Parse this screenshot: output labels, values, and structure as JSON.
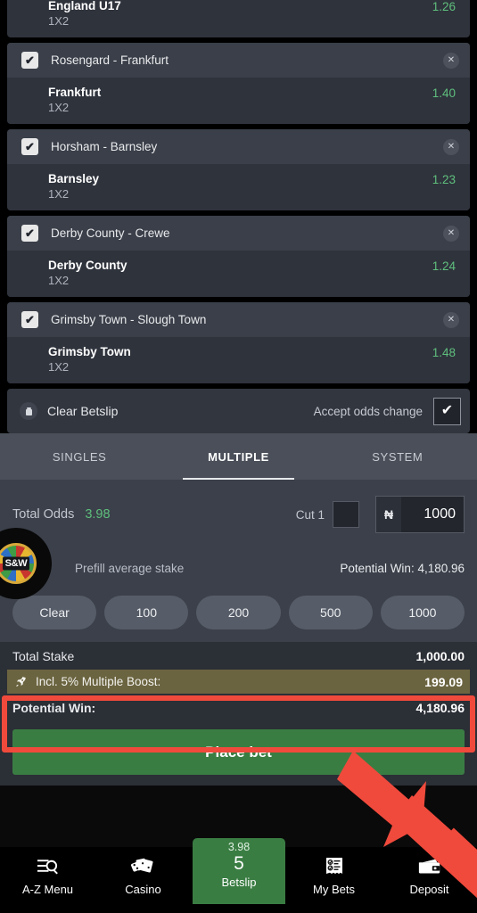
{
  "betslip": {
    "items": [
      {
        "match": "",
        "pick": "England U17",
        "market": "1X2",
        "odds": "1.26",
        "partial": true
      },
      {
        "match": "Rosengard - Frankfurt",
        "pick": "Frankfurt",
        "market": "1X2",
        "odds": "1.40"
      },
      {
        "match": "Horsham - Barnsley",
        "pick": "Barnsley",
        "market": "1X2",
        "odds": "1.23"
      },
      {
        "match": "Derby County - Crewe",
        "pick": "Derby County",
        "market": "1X2",
        "odds": "1.24"
      },
      {
        "match": "Grimsby Town - Slough Town",
        "pick": "Grimsby Town",
        "market": "1X2",
        "odds": "1.48"
      }
    ],
    "clear_label": "Clear Betslip",
    "accept_odds_label": "Accept odds change",
    "accept_odds_checked": true,
    "checkbox_glyph": "✔",
    "close_glyph": "✕"
  },
  "tabs": [
    {
      "label": "SINGLES",
      "active": false
    },
    {
      "label": "MULTIPLE",
      "active": true
    },
    {
      "label": "SYSTEM",
      "active": false
    }
  ],
  "stake": {
    "total_odds_label": "Total Odds",
    "total_odds_value": "3.98",
    "cut_label": "Cut 1",
    "cut_checked": false,
    "currency_symbol": "₦",
    "stake_value": "1000",
    "prefill_label": "Prefill average stake",
    "wheel_text": "S&W",
    "potential_win_inline": "Potential Win: 4,180.96",
    "quick_buttons": [
      "Clear",
      "100",
      "200",
      "500",
      "1000"
    ]
  },
  "summary": {
    "total_stake_label": "Total Stake",
    "total_stake_value": "1,000.00",
    "boost_label": "Incl. 5% Multiple Boost:",
    "boost_value": "199.09",
    "potential_win_label": "Potential Win:",
    "potential_win_value": "4,180.96",
    "place_bet_label": "Place bet"
  },
  "bottom_nav": {
    "items": [
      {
        "label": "A-Z Menu",
        "icon": "az-menu-icon"
      },
      {
        "label": "Casino",
        "icon": "casino-dice-cards-icon"
      },
      {
        "label": "My Bets",
        "icon": "my-bets-receipt-icon"
      },
      {
        "label": "Deposit",
        "icon": "wallet-icon"
      }
    ],
    "betslip": {
      "odds": "3.98",
      "count": "5",
      "label": "Betslip"
    }
  },
  "colors": {
    "accent_green": "#5fbf7d",
    "place_bet_green": "#3a7d43",
    "boost_olive": "#6b6440",
    "highlight_red": "#f04a3c",
    "card_bg": "#2f333c",
    "header_bg": "#3a3f49"
  }
}
